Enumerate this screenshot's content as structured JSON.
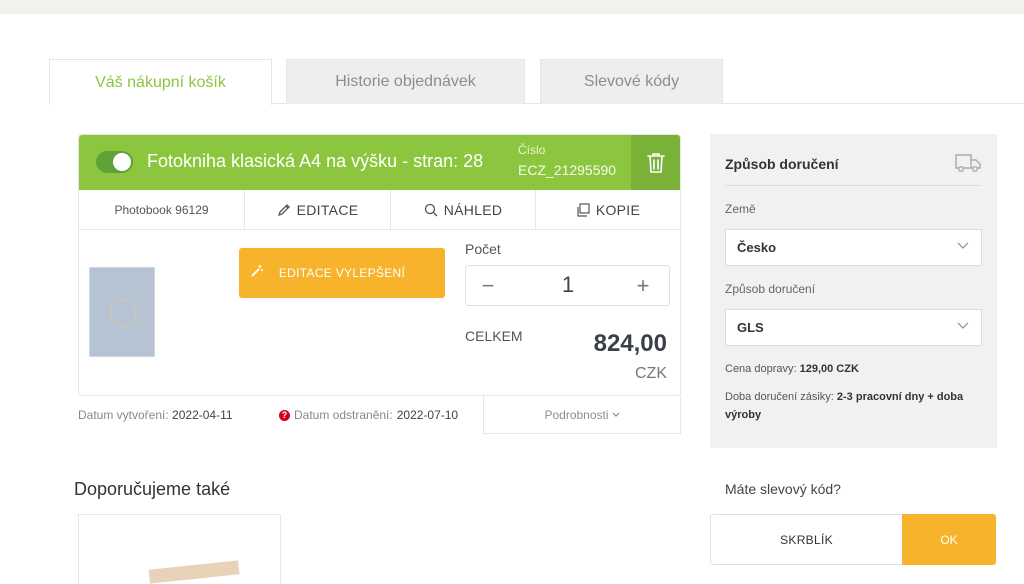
{
  "tabs": [
    {
      "label": "Váš nákupní košík",
      "active": true
    },
    {
      "label": "Historie objednávek",
      "active": false
    },
    {
      "label": "Slevové kódy",
      "active": false
    }
  ],
  "cart_item": {
    "title": "Fotokniha klasická A4 na výšku - stran: 28",
    "number_label": "Číslo",
    "number_value": "ECZ_21295590",
    "toggle_on": true,
    "product_code": "Photobook 96129",
    "actions": {
      "edit": "EDITACE",
      "preview": "NÁHLED",
      "copy": "KOPIE"
    },
    "enhance_button": "EDITACE VYLEPŠENÍ",
    "quantity_label": "Počet",
    "quantity": "1",
    "minus": "−",
    "plus": "+",
    "total_label": "CELKEM",
    "total_value": "824,00",
    "currency": "CZK",
    "created_label": "Datum vytvoření:",
    "created_value": "2022-04-11",
    "removal_label": "Datum odstranění:",
    "removal_value": "2022-07-10",
    "details_link": "Podrobnosti"
  },
  "recommend": {
    "title": "Doporučujeme také"
  },
  "shipping": {
    "title": "Způsob doručení",
    "country_label": "Země",
    "country_value": "Česko",
    "method_label": "Způsob doručení",
    "method_value": "GLS",
    "price_label": "Cena dopravy:",
    "price_value": "129,00 CZK",
    "delivery_label": "Doba doručení zásiky:",
    "delivery_value": "2-3 pracovní dny + doba výroby"
  },
  "promo": {
    "question": "Máte slevový kód?",
    "code_value": "SKRBLÍK",
    "ok_label": "OK"
  },
  "colors": {
    "brand_green": "#8cc63f",
    "accent_yellow": "#f7b32b"
  }
}
